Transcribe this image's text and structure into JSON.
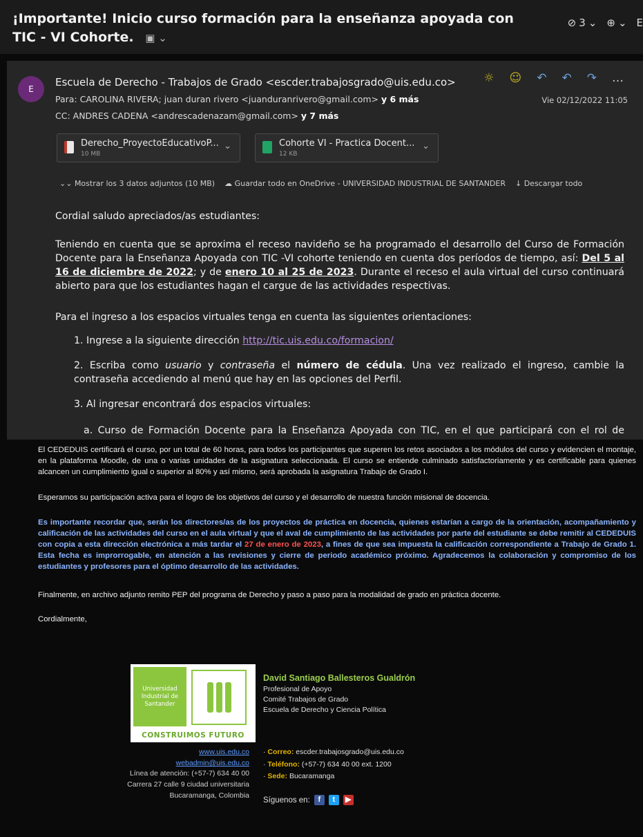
{
  "subject": {
    "title": "¡Importante! Inicio curso formación para la enseñanza apoyada con TIC - VI Cohorte.",
    "tag_icon": "summary-icon",
    "attachment_count": "3",
    "zoom_icon": "zoom-icon"
  },
  "header": {
    "avatar_letter": "E",
    "from": "Escuela de Derecho - Trabajos de Grado <escder.trabajosgrado@uis.edu.co>",
    "to_label": "Para:",
    "to_value": "CAROLINA RIVERA; juan duran rivero <juanduranrivero@gmail.com>",
    "to_more": "y 6 más",
    "cc_label": "CC:",
    "cc_value": "ANDRES CADENA <andrescadenazam@gmail.com>",
    "cc_more": "y 7 más",
    "date": "Vie 02/12/2022 11:05"
  },
  "attachments": [
    {
      "name": "Derecho_ProyectoEducativoP...",
      "size": "10 MB",
      "icon": "pdf-file-icon"
    },
    {
      "name": "Cohorte VI - Practica Docent...",
      "size": "12 KB",
      "icon": "excel-file-icon"
    }
  ],
  "attachment_actions": {
    "show_all": "Mostrar los 3 datos adjuntos (10 MB)",
    "save_onedrive": "Guardar todo en OneDrive - UNIVERSIDAD INDUSTRIAL DE SANTANDER",
    "download_all": "Descargar todo"
  },
  "body": {
    "greeting": "Cordial saludo apreciados/as estudiantes:",
    "intro_a": "Teniendo en cuenta que se aproxima el receso navideño se ha programado el desarrollo del Curso de Formación Docente para la Enseñanza Apoyada con TIC -VI cohorte teniendo en cuenta dos períodos de tiempo, así: ",
    "intro_period1": "Del 5 al 16 de diciembre de 2022",
    "intro_b": "; y de ",
    "intro_period2": "enero 10 al 25 de 2023",
    "intro_c": ". Durante el receso el aula virtual del curso continuará abierto para que los estudiantes hagan el cargue de las actividades respectivas.",
    "ingreso": "Para el ingreso a los espacios virtuales tenga en cuenta las siguientes orientaciones:",
    "item1_a": "1. Ingrese a la siguiente dirección ",
    "item1_link": "http://tic.uis.edu.co/formacion/",
    "item2_a": "2. Escriba como ",
    "item2_user": "usuario",
    "item2_b": " y ",
    "item2_pass": "contraseña",
    "item2_c": " el ",
    "item2_cedula": "número de cédula",
    "item2_d": ". Una vez realizado el ingreso, cambie la contraseña accediendo al menú que hay en las opciones del Perfil.",
    "item3": "3. Al ingresar encontrará dos espacios virtuales:",
    "item_a": "a. Curso de Formación Docente para la Enseñanza Apoyada con TIC, en el que participará con el rol de estudiante."
  },
  "lower": {
    "p1": "El CEDEDUIS certificará el curso, por un total de 60 horas, para todos los participantes que superen los retos asociados a los módulos del curso y evidencien el montaje, en la plataforma Moodle, de una o varias unidades de la asignatura seleccionada. El curso se entiende culminado satisfactoriamente y es certificable para quienes alcancen un cumplimiento igual o superior al 80% y así mismo, será aprobada la asignatura Trabajo de Grado I.",
    "p2": "Esperamos su participación activa para el logro de los objetivos del curso y el desarrollo de nuestra función misional de docencia.",
    "p3_a": "Es importante recordar que, serán los directores/as de los proyectos de práctica en docencia, quienes estarían a cargo de la orientación, acompañamiento y calificación de las actividades del curso en el aula virtual y que el aval de cumplimiento de las actividades por parte del estudiante se debe remitir al CEDEDUIS con copia a esta dirección electrónica a más tardar el ",
    "p3_date": "27 de enero de 2023",
    "p3_b": ", a fines de que sea impuesta la calificación correspondiente a Trabajo de Grado 1. Esta fecha es improrrogable, en atención a las revisiones y cierre de periodo académico próximo. Agradecemos la colaboración y compromiso de los estudiantes y profesores para el óptimo desarrollo de las actividades.",
    "p4": "Finalmente, en archivo adjunto remito PEP del programa de Derecho y paso a paso para la modalidad de grado en práctica docente.",
    "closing": "Cordialmente,"
  },
  "signature": {
    "logo_text": "Universidad Industrial de Santander",
    "logo_slogan": "CONSTRUIMOS FUTURO",
    "name": "David Santiago Ballesteros Gualdrón",
    "role": "Profesional de Apoyo",
    "committee": "Comité Trabajos de Grado",
    "school": "Escuela de Derecho y Ciencia Política",
    "web": "www.uis.edu.co",
    "webadmin": "webadmin@uis.edu.co",
    "attention": "Línea de atención: (+57-7) 634 40 00",
    "address1": "Carrera 27 calle 9 ciudad universitaria",
    "address2": "Bucaramanga, Colombia",
    "email_label": "Correo:",
    "email": "escder.trabajosgrado@uis.edu.co",
    "phone_label": "Teléfono:",
    "phone": "(+57-7) 634 40 00 ext. 1200",
    "site_label": "Sede:",
    "site": "Bucaramanga",
    "follow": "Síguenos en:"
  }
}
